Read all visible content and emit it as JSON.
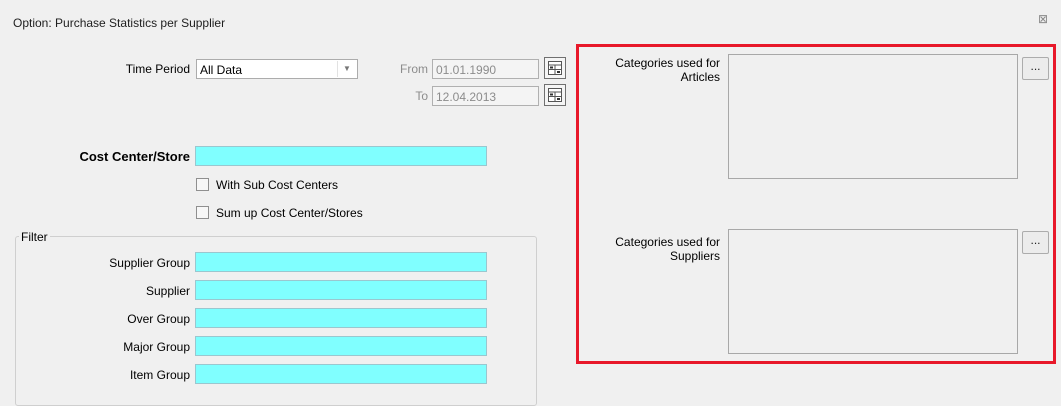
{
  "window": {
    "title": "Option: Purchase Statistics per Supplier",
    "close_glyph": "⊠"
  },
  "time_period": {
    "label": "Time Period",
    "value": "All Data",
    "from_label": "From",
    "from_value": "01.01.1990",
    "to_label": "To",
    "to_value": "12.04.2013"
  },
  "cost_center": {
    "label": "Cost Center/Store",
    "value": "",
    "with_sub_label": "With Sub Cost Centers",
    "with_sub_checked": false,
    "sum_up_label": "Sum up Cost Center/Stores",
    "sum_up_checked": false
  },
  "filter": {
    "legend": "Filter",
    "fields": [
      {
        "label": "Supplier Group",
        "value": ""
      },
      {
        "label": "Supplier",
        "value": ""
      },
      {
        "label": "Over Group",
        "value": ""
      },
      {
        "label": "Major Group",
        "value": ""
      },
      {
        "label": "Item Group",
        "value": ""
      }
    ]
  },
  "categories": {
    "articles_label_line1": "Categories used for",
    "articles_label_line2": "Articles",
    "suppliers_label_line1": "Categories used for",
    "suppliers_label_line2": "Suppliers",
    "browse_label": "..."
  },
  "colors": {
    "lookup_field_bg": "#80ffff",
    "highlight_border": "#e8182a",
    "window_bg": "#f0f0f0"
  },
  "icons": {
    "calendar": "calendar-icon",
    "dropdown": "chevron-down-icon",
    "close": "close-icon"
  }
}
